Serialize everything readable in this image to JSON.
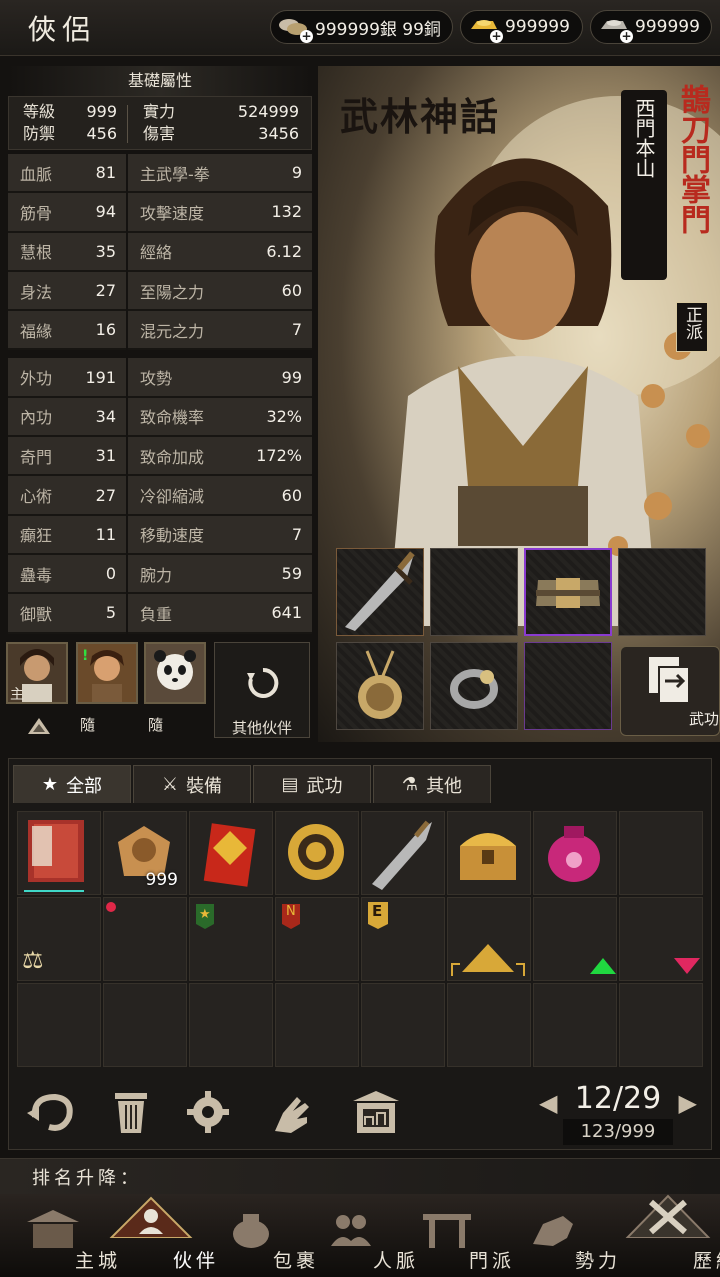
{
  "header": {
    "title": "俠侶",
    "currencies": [
      {
        "name": "silver-coin-icon",
        "text": "999999銀 99銅"
      },
      {
        "name": "gold-ingot-icon",
        "text": "999999"
      },
      {
        "name": "silver-ingot-icon",
        "text": "999999"
      }
    ]
  },
  "stats": {
    "title": "基礎屬性",
    "top": {
      "level_label": "等級",
      "level": "999",
      "defense_label": "防禦",
      "defense": "456",
      "power_label": "實力",
      "power": "524999",
      "damage_label": "傷害",
      "damage": "3456"
    },
    "group1": [
      {
        "l": "血脈",
        "lv": "81",
        "r": "主武學-拳",
        "rv": "9"
      },
      {
        "l": "筋骨",
        "lv": "94",
        "r": "攻擊速度",
        "rv": "132"
      },
      {
        "l": "慧根",
        "lv": "35",
        "r": "經絡",
        "rv": "6.12"
      },
      {
        "l": "身法",
        "lv": "27",
        "r": "至陽之力",
        "rv": "60"
      },
      {
        "l": "福緣",
        "lv": "16",
        "r": "混元之力",
        "rv": "7"
      }
    ],
    "group2": [
      {
        "l": "外功",
        "lv": "191",
        "r": "攻勢",
        "rv": "99"
      },
      {
        "l": "內功",
        "lv": "34",
        "r": "致命機率",
        "rv": "32%"
      },
      {
        "l": "奇門",
        "lv": "31",
        "r": "致命加成",
        "rv": "172%"
      },
      {
        "l": "心術",
        "lv": "27",
        "r": "冷卻縮減",
        "rv": "60"
      },
      {
        "l": "癲狂",
        "lv": "11",
        "r": "移動速度",
        "rv": "7"
      },
      {
        "l": "蠱毒",
        "lv": "0",
        "r": "腕力",
        "rv": "59"
      },
      {
        "l": "御獸",
        "lv": "5",
        "r": "負重",
        "rv": "641"
      }
    ]
  },
  "companions": [
    {
      "role": "主"
    },
    {
      "role": "隨"
    },
    {
      "role": "隨"
    }
  ],
  "others_label": "其他伙伴",
  "hero": {
    "logo": "武林神話",
    "name": "西門本山",
    "sect": "鵲刀門掌門",
    "alignment": "正派"
  },
  "wugong_button": "武功界面",
  "tabs": [
    "全部",
    "裝備",
    "武功",
    "其他"
  ],
  "items": [
    {
      "name": "book-item",
      "qty": ""
    },
    {
      "name": "coin-bag-item",
      "qty": "999"
    },
    {
      "name": "red-envelope-item",
      "qty": ""
    },
    {
      "name": "gold-medallion-item",
      "qty": ""
    },
    {
      "name": "broadsword-item",
      "qty": ""
    },
    {
      "name": "treasure-chest-item",
      "qty": ""
    },
    {
      "name": "pink-pouch-item",
      "qty": ""
    }
  ],
  "row2_marks": {
    "n": "N",
    "e": "E"
  },
  "pager": {
    "main": "12/29",
    "sub": "123/999"
  },
  "sort_label": "排名升降：",
  "nav": [
    "主城",
    "伙伴",
    "包裹",
    "人脈",
    "門派",
    "勢力",
    "歷練"
  ]
}
